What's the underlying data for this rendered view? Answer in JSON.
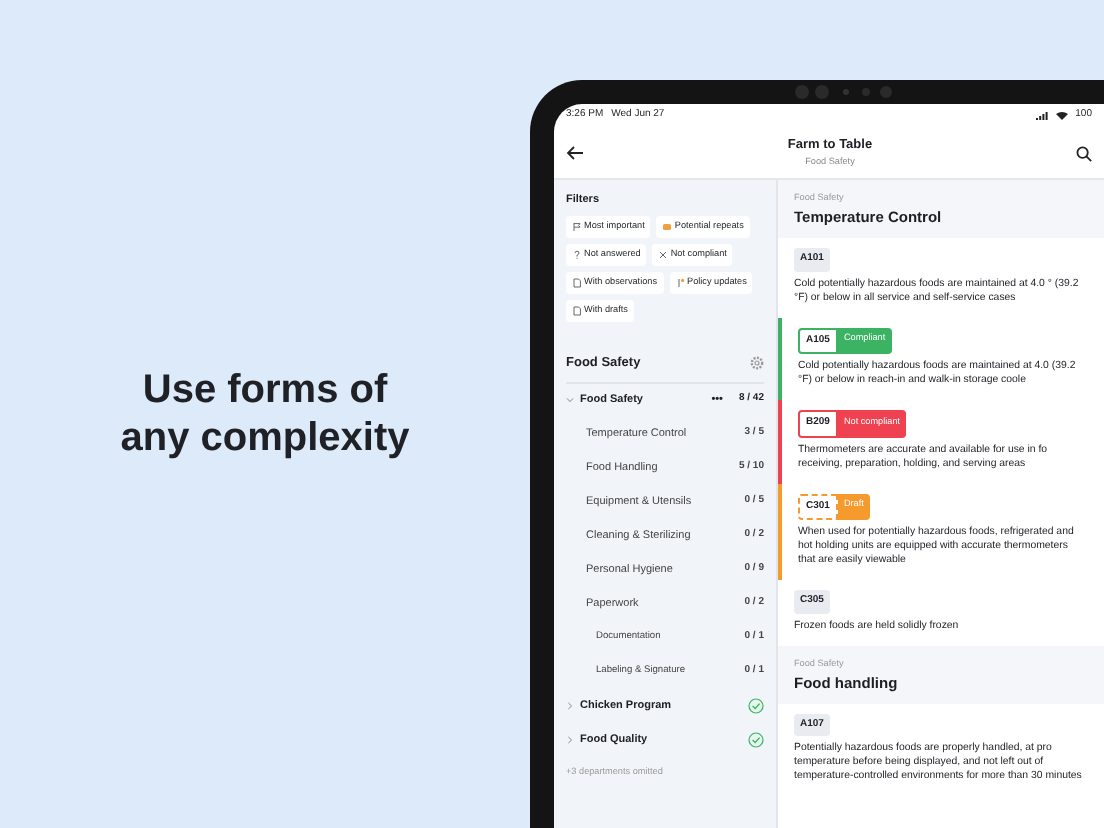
{
  "headline": "Use forms of any complexity",
  "status_bar": {
    "time": "3:26 PM",
    "date": "Wed Jun 27",
    "battery": "100"
  },
  "header": {
    "title": "Farm to Table",
    "subtitle": "Food Safety"
  },
  "filters": {
    "title": "Filters",
    "chips": [
      {
        "label": "Most important",
        "kind": "flag"
      },
      {
        "label": "Potential repeats",
        "kind": "repeat"
      },
      {
        "label": "Not answered",
        "kind": "question"
      },
      {
        "label": "Not compliant",
        "kind": "cross"
      },
      {
        "label": "With observations",
        "kind": "note"
      },
      {
        "label": "Policy updates",
        "kind": "policy"
      },
      {
        "label": "With drafts",
        "kind": "note"
      }
    ]
  },
  "sidebar": {
    "title": "Food Safety",
    "tree": [
      {
        "label": "Food Safety",
        "count": "8 / 42",
        "more": "•••",
        "expanded": true,
        "done": false,
        "children": [
          {
            "label": "Temperature Control",
            "count": "3 / 5"
          },
          {
            "label": "Food Handling",
            "count": "5 / 10"
          },
          {
            "label": "Equipment & Utensils",
            "count": "0 / 5"
          },
          {
            "label": "Cleaning & Sterilizing",
            "count": "0 / 2"
          },
          {
            "label": "Personal Hygiene",
            "count": "0 / 9"
          },
          {
            "label": "Paperwork",
            "count": "0 / 2",
            "children": [
              {
                "label": "Documentation",
                "count": "0 / 1"
              },
              {
                "label": "Labeling & Signature",
                "count": "0 / 1"
              }
            ]
          }
        ]
      },
      {
        "label": "Chicken Program",
        "expanded": false,
        "done": true
      },
      {
        "label": "Food Quality",
        "expanded": false,
        "done": true
      }
    ],
    "note": "+3 departments omitted"
  },
  "sections": [
    {
      "eyebrow": "Food Safety",
      "title": "Temperature Control",
      "questions": [
        {
          "code": "A101",
          "kind": "plain",
          "text": "Cold potentially hazardous foods are maintained at 4.0 ° (39.2 °F) or below in all service and self-service cases"
        },
        {
          "code": "A105",
          "kind": "compliant",
          "status_label": "Compliant",
          "text": "Cold potentially hazardous foods are maintained at 4.0 (39.2 °F) or below in reach-in and walk-in storage coole"
        },
        {
          "code": "B209",
          "kind": "not_compliant",
          "status_label": "Not compliant",
          "text": "Thermometers are accurate and available for use in fo receiving, preparation, holding, and serving areas"
        },
        {
          "code": "C301",
          "kind": "draft",
          "status_label": "Draft",
          "text": "When used for potentially hazardous foods, refrigerated and hot holding units are equipped with accurate thermometers that are easily viewable"
        },
        {
          "code": "C305",
          "kind": "plain",
          "text": "Frozen foods are held solidly frozen"
        }
      ]
    },
    {
      "eyebrow": "Food Safety",
      "title": "Food handling",
      "questions": [
        {
          "code": "A107",
          "kind": "plain",
          "text": "Potentially hazardous foods are properly handled, at pro temperature before being displayed, and not left out of temperature-controlled environments for more than 30 minutes"
        }
      ]
    }
  ]
}
